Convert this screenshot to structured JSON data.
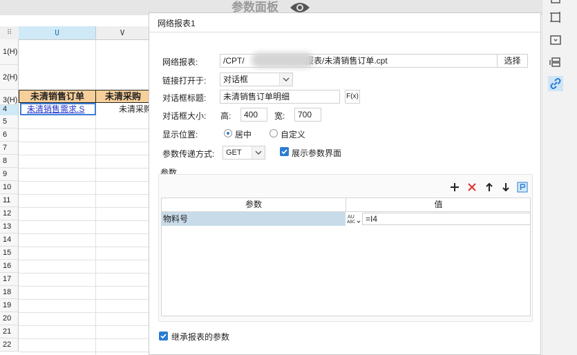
{
  "topbar": {
    "title": "参数面板",
    "eye_icon": "eye-icon"
  },
  "sheet": {
    "columns": [
      "U",
      "V"
    ],
    "rows": [
      "1(H)",
      "2(H)",
      "3(H)",
      "4",
      "5",
      "6",
      "7",
      "8",
      "9",
      "10",
      "11",
      "12",
      "13",
      "14",
      "15",
      "16",
      "17",
      "18",
      "19",
      "20",
      "21",
      "22"
    ],
    "header_cells": [
      "未清销售订单",
      "未清采购"
    ],
    "data_cells": [
      "未清销售需求.S",
      "未清采购"
    ]
  },
  "dialog": {
    "title": "网络报表1",
    "report_label": "网络报表:",
    "report_path_prefix": "/CPT/",
    "report_path_suffix": "t报表/未清销售订单.cpt",
    "select_button": "选择",
    "open_in_label": "链接打开于:",
    "open_in_value": "对话框",
    "dialog_title_label": "对话框标题:",
    "dialog_title_value": "未清销售订单明细",
    "formula_button": "F(x)",
    "size_label": "对话框大小:",
    "height_label": "高:",
    "height_value": "400",
    "width_label": "宽:",
    "width_value": "700",
    "position_label": "显示位置:",
    "position_center": "居中",
    "position_custom": "自定义",
    "param_method_label": "参数传递方式:",
    "param_method_value": "GET",
    "show_param_label": "展示参数界面",
    "params_group_label": "参数",
    "params_table": {
      "col_param": "参数",
      "col_value": "值",
      "rows": [
        {
          "name": "物料号",
          "value": "=I4"
        }
      ]
    },
    "inherit_label": "继承报表的参数"
  },
  "colors": {
    "accent": "#2b7cd3",
    "header_fill": "#f7cf9a",
    "selected_row": "#c8dbe9",
    "danger": "#e03030"
  }
}
